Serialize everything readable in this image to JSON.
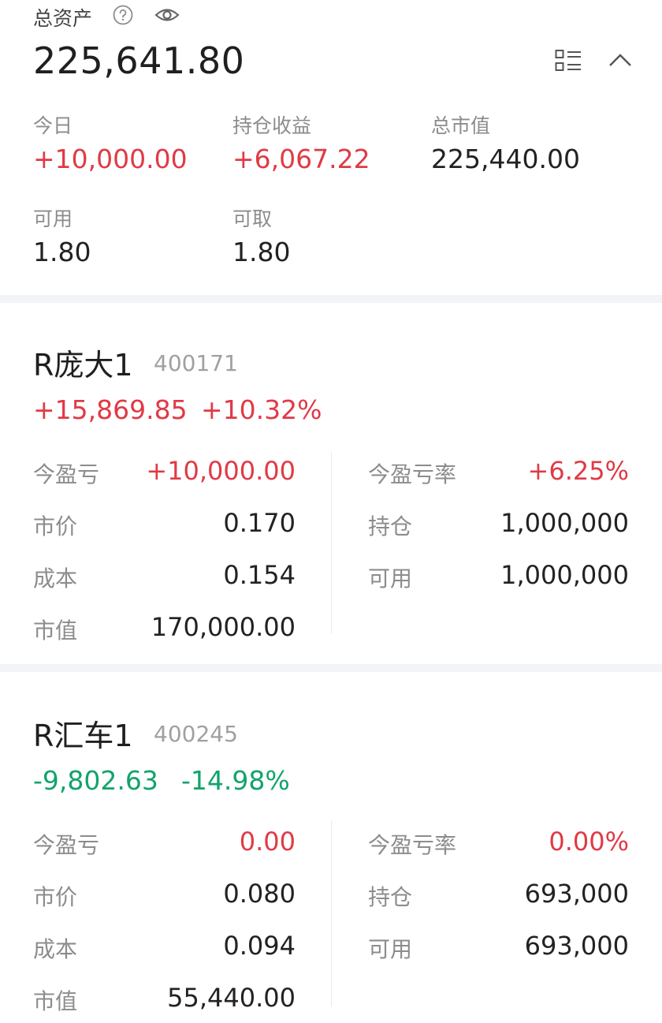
{
  "summary": {
    "label": "总资产",
    "total": "225,641.80",
    "stats": [
      {
        "label": "今日",
        "value": "+10,000.00",
        "color": "red"
      },
      {
        "label": "持仓收益",
        "value": "+6,067.22",
        "color": "red"
      },
      {
        "label": "总市值",
        "value": "225,440.00",
        "color": "default"
      },
      {
        "label": "可用",
        "value": "1.80",
        "color": "default"
      },
      {
        "label": "可取",
        "value": "1.80",
        "color": "default"
      }
    ]
  },
  "icons": {
    "help": "help-circle-icon",
    "eye": "eye-icon",
    "list": "list-icon",
    "collapse": "chevron-up-icon"
  },
  "colors": {
    "up": "#e03a45",
    "down": "#12a36b",
    "divider": "#f3f4f7"
  },
  "positions": [
    {
      "name": "R庞大1",
      "code": "400171",
      "pnl": "+15,869.85",
      "pnl_pct": "+10.32%",
      "trend": "up",
      "left": [
        {
          "label": "今盈亏",
          "value": "+10,000.00",
          "color": "red"
        },
        {
          "label": "市价",
          "value": "0.170",
          "color": "default"
        },
        {
          "label": "成本",
          "value": "0.154",
          "color": "default"
        },
        {
          "label": "市值",
          "value": "170,000.00",
          "color": "default"
        }
      ],
      "right": [
        {
          "label": "今盈亏率",
          "value": "+6.25%",
          "color": "red"
        },
        {
          "label": "持仓",
          "value": "1,000,000",
          "color": "default"
        },
        {
          "label": "可用",
          "value": "1,000,000",
          "color": "default"
        }
      ]
    },
    {
      "name": "R汇车1",
      "code": "400245",
      "pnl": "-9,802.63",
      "pnl_pct": "-14.98%",
      "trend": "down",
      "left": [
        {
          "label": "今盈亏",
          "value": "0.00",
          "color": "red"
        },
        {
          "label": "市价",
          "value": "0.080",
          "color": "default"
        },
        {
          "label": "成本",
          "value": "0.094",
          "color": "default"
        },
        {
          "label": "市值",
          "value": "55,440.00",
          "color": "default"
        }
      ],
      "right": [
        {
          "label": "今盈亏率",
          "value": "0.00%",
          "color": "red"
        },
        {
          "label": "持仓",
          "value": "693,000",
          "color": "default"
        },
        {
          "label": "可用",
          "value": "693,000",
          "color": "default"
        }
      ]
    }
  ]
}
